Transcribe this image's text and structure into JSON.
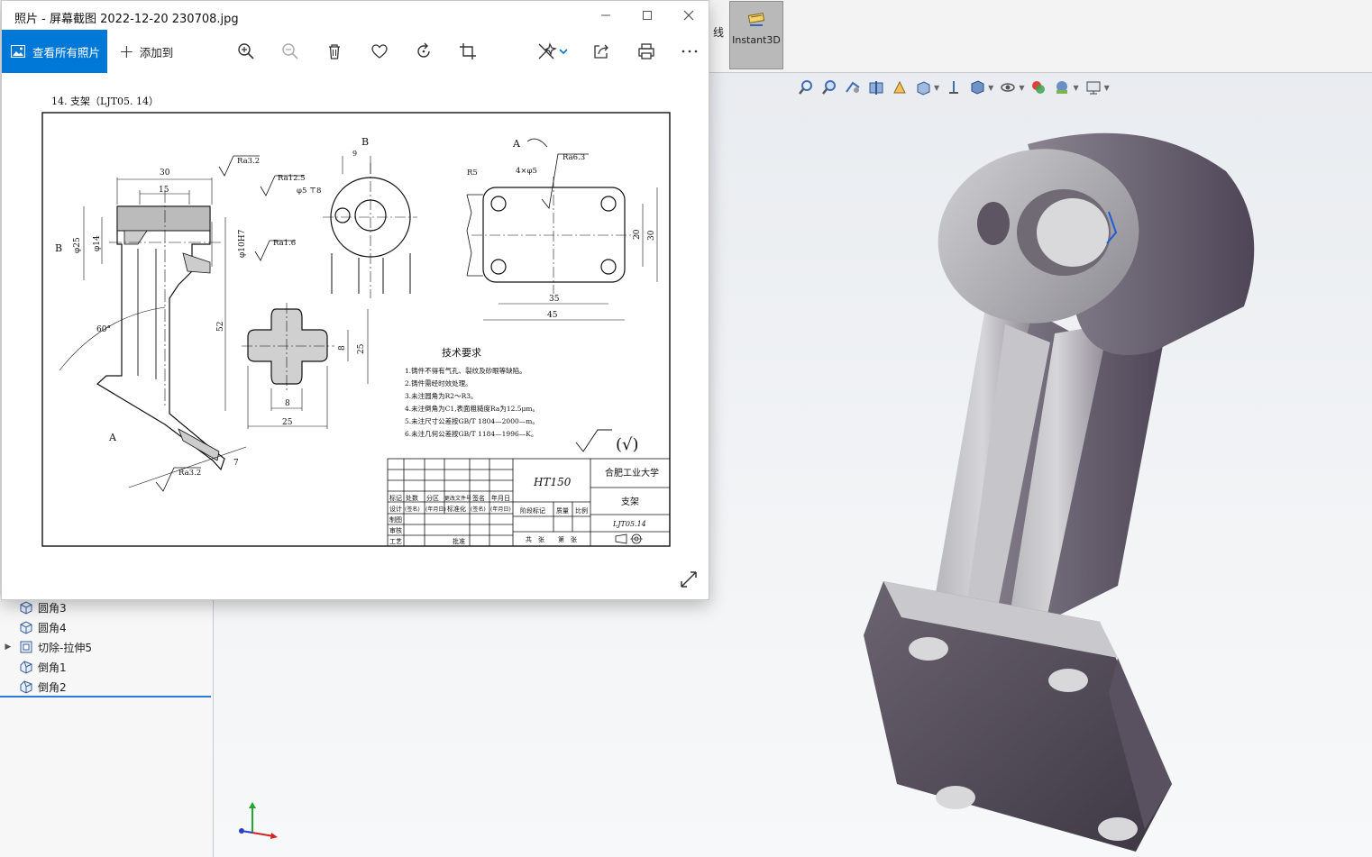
{
  "photos_window": {
    "title": "照片 - 屏幕截图 2022-12-20 230708.jpg",
    "view_all_label": "查看所有照片",
    "add_to_label": "添加到",
    "icons": [
      "zoom-in-icon",
      "zoom-out-icon",
      "delete-icon",
      "favorite-icon",
      "rotate-icon",
      "crop-icon",
      "edit-icon",
      "share-icon",
      "print-icon",
      "more-icon"
    ]
  },
  "drawing": {
    "title": "14.  支架（LJT05. 14）",
    "view_labels": {
      "b_top": "B",
      "b_left": "B",
      "a_right": "A",
      "a_left": "A"
    },
    "dims": {
      "d30": "30",
      "d15": "15",
      "d25": "φ25",
      "d14": "φ14",
      "d10": "φ10H7",
      "d52": "52",
      "ang60": "60°",
      "d9": "9",
      "hole5": "φ5 ⊤8",
      "r5": "R5",
      "holes4": "4×φ5",
      "d20": "20",
      "d30r": "30",
      "d35": "35",
      "d45": "45",
      "c8": "8",
      "c25": "25",
      "c8b": "8",
      "c25b": "25",
      "d7": "7"
    },
    "roughness": {
      "r1": "Ra3.2",
      "r2": "Ra12.5",
      "r3": "Ra1.6",
      "r4": "Ra6.3",
      "r5": "Ra3.2"
    },
    "tech_title": "技术要求",
    "tech_notes": [
      "1.铸件不得有气孔、裂纹及砂眼等缺陷。",
      "2.铸件需经时效处理。",
      "3.未注圆角为R2～R3。",
      "4.未注倒角为C1,表面粗糙度Ra为12.5μm。",
      "5.未注尺寸公差按GB/T 1804—2000—m。",
      "6.未注几何公差按GB/T 1184—1996—K。"
    ],
    "roughness_general": "(√)",
    "title_block": {
      "material": "HT150",
      "school": "合肥工业大学",
      "part_name": "支架",
      "drawing_no": "LJT05.14",
      "h_mark": "标记",
      "h_count": "处数",
      "h_zone": "分区",
      "h_docno": "更改文件号",
      "h_sign": "签名",
      "h_date": "年月日",
      "r_design": "设计",
      "r_sign2": "(签名)",
      "r_date2": "(年月日)",
      "r_std": "标准化",
      "r_sign3": "(签名)",
      "r_date3": "(年月日)",
      "r_draw": "制图",
      "r_check": "审核",
      "r_process": "工艺",
      "r_approve": "批准",
      "stage": "阶段标记",
      "weight": "质量",
      "scale": "比例",
      "total": "共　张",
      "sheet": "第　张"
    }
  },
  "cad": {
    "line_label": "线",
    "instant3d_label": "Instant3D",
    "heads_up_icons": [
      "zoom-fit-icon",
      "zoom-area-icon",
      "previous-view-icon",
      "section-view-icon",
      "dynamic-annotation-icon",
      "view-orientation-icon",
      "display-style-icon",
      "hide-show-icon",
      "edit-appearance-icon",
      "apply-scene-icon",
      "view-settings-icon"
    ],
    "tree_items": [
      {
        "label": "圆角3",
        "expandable": false
      },
      {
        "label": "圆角4",
        "expandable": false
      },
      {
        "label": "切除-拉伸5",
        "expandable": true
      },
      {
        "label": "倒角1",
        "expandable": false
      },
      {
        "label": "倒角2",
        "expandable": false
      }
    ],
    "colors": {
      "accent": "#0078d7",
      "model_face": "#a9a9ad",
      "model_shadow": "#5e5566",
      "viewport_bg": "#eceef1"
    }
  }
}
